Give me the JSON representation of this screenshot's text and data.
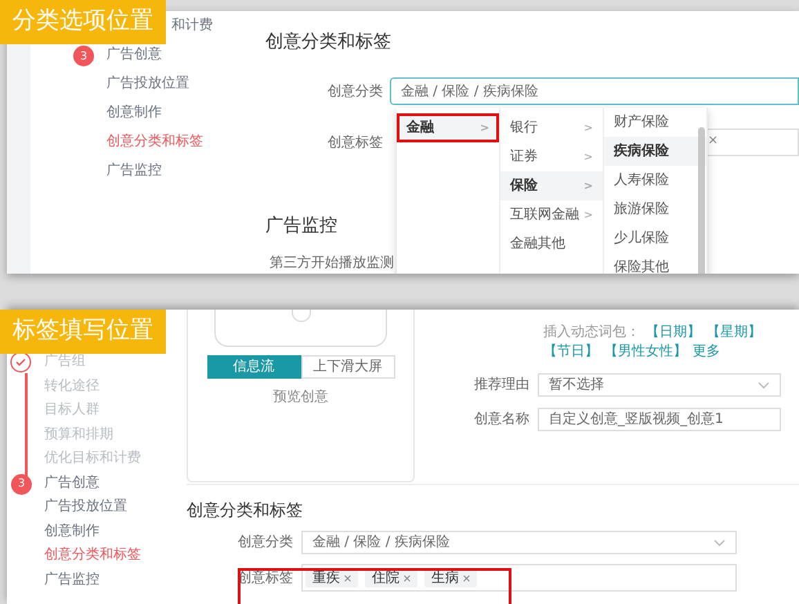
{
  "top_panel": {
    "callout": "分类选项位置",
    "sidebar": [
      {
        "label": "和计费",
        "kind": "partial",
        "selected": false
      },
      {
        "label": "广告创意",
        "kind": "step",
        "step": "3",
        "selected": false
      },
      {
        "label": "广告投放位置",
        "kind": "plain",
        "selected": false
      },
      {
        "label": "创意制作",
        "kind": "plain",
        "selected": false
      },
      {
        "label": "创意分类和标签",
        "kind": "plain",
        "selected": true
      },
      {
        "label": "广告监控",
        "kind": "plain",
        "selected": false
      }
    ],
    "heading": "创意分类和标签",
    "category": {
      "label": "创意分类",
      "value": "金融 / 保险 / 疾病保险"
    },
    "tags": {
      "label": "创意标签",
      "partial_tag_close": "×"
    },
    "cascader": [
      {
        "items": [
          {
            "label": "金融",
            "arrow": ">",
            "selected": true,
            "outlined": true
          }
        ]
      },
      {
        "items": [
          {
            "label": "银行",
            "arrow": ">",
            "selected": false,
            "outlined": false
          },
          {
            "label": "证券",
            "arrow": ">",
            "selected": false,
            "outlined": false
          },
          {
            "label": "保险",
            "arrow": ">",
            "selected": true,
            "outlined": false
          },
          {
            "label": "互联网金融",
            "arrow": ">",
            "selected": false,
            "outlined": false
          },
          {
            "label": "金融其他",
            "selected": false,
            "outlined": false
          }
        ]
      },
      {
        "items": [
          {
            "label": "财产保险",
            "selected": false,
            "outlined": false
          },
          {
            "label": "疾病保险",
            "selected": true,
            "outlined": false
          },
          {
            "label": "人寿保险",
            "selected": false,
            "outlined": false
          },
          {
            "label": "旅游保险",
            "selected": false,
            "outlined": false
          },
          {
            "label": "少儿保险",
            "selected": false,
            "outlined": false
          },
          {
            "label": "保险其他",
            "selected": false,
            "outlined": false
          }
        ]
      }
    ],
    "monitor_heading": "广告监控",
    "monitor_label": "第三方开始播放监测"
  },
  "bottom_panel": {
    "callout": "标签填写位置",
    "sidebar": [
      {
        "label": "广告组",
        "kind": "check",
        "selected": false
      },
      {
        "label": "转化途径",
        "kind": "done",
        "selected": false
      },
      {
        "label": "目标人群",
        "kind": "done",
        "selected": false
      },
      {
        "label": "预算和排期",
        "kind": "done",
        "selected": false
      },
      {
        "label": "优化目标和计费",
        "kind": "done",
        "selected": false
      },
      {
        "label": "广告创意",
        "kind": "step",
        "step": "3",
        "selected": false
      },
      {
        "label": "广告投放位置",
        "kind": "plain",
        "selected": false
      },
      {
        "label": "创意制作",
        "kind": "plain",
        "selected": false
      },
      {
        "label": "创意分类和标签",
        "kind": "plain",
        "selected": true
      },
      {
        "label": "广告监控",
        "kind": "plain",
        "selected": false
      }
    ],
    "preview_tabs": [
      {
        "label": "信息流",
        "selected": true
      },
      {
        "label": "上下滑大屏",
        "selected": false
      }
    ],
    "preview_link": "预览创意",
    "dynamic_words": {
      "label": "插入动态词包：",
      "links": [
        "【日期】",
        "【星期】",
        "【节日】",
        "【男性女性】",
        "更多"
      ]
    },
    "reason": {
      "label": "推荐理由",
      "value": "暂不选择"
    },
    "name": {
      "label": "创意名称",
      "value": "自定义创意_竖版视频_创意1"
    },
    "heading": "创意分类和标签",
    "category": {
      "label": "创意分类",
      "value": "金融 / 保险 / 疾病保险"
    },
    "tags": {
      "label": "创意标签",
      "items": [
        "重疾",
        "住院",
        "生病"
      ],
      "outlined": true
    }
  }
}
